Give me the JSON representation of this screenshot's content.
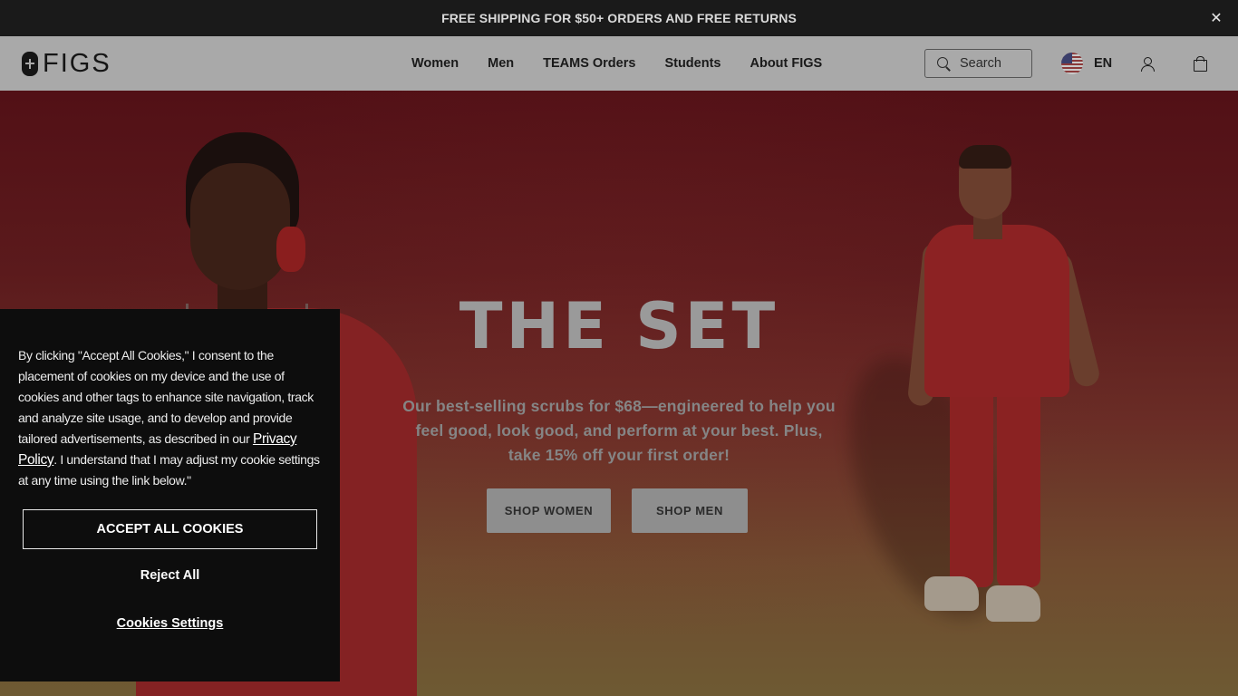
{
  "announcement": {
    "text": "FREE SHIPPING FOR $50+ ORDERS AND FREE RETURNS",
    "close_glyph": "✕"
  },
  "header": {
    "logo_text": "FIGS",
    "nav": [
      "Women",
      "Men",
      "TEAMS Orders",
      "Students",
      "About FIGS"
    ],
    "search_placeholder": "Search",
    "language": "EN",
    "icons": [
      "search-icon",
      "us-flag-icon",
      "account-icon",
      "shopping-bag-icon"
    ]
  },
  "hero": {
    "title": "THE SET",
    "subtitle": "Our best-selling scrubs for $68—engineered to help you feel good, look good, and perform at your best. Plus, take 15% off your first order!",
    "shop_women": "SHOP WOMEN",
    "shop_men": "SHOP MEN"
  },
  "cookie_banner": {
    "text_before_link": "By clicking \"Accept All Cookies,\" I consent to the placement of cookies on my device and the use of cookies and other tags to enhance site navigation, track and analyze site usage, and to develop and provide tailored advertisements, as described in our ",
    "privacy_link": "Privacy Policy",
    "text_after_link": ". I understand that I may adjust my cookie settings at any time using the link below.\"",
    "accept_label": "ACCEPT ALL COOKIES",
    "reject_label": "Reject All",
    "settings_label": "Cookies Settings"
  },
  "colors": {
    "announcement_bg": "#1a1a1a",
    "header_bg": "#a9a9a9",
    "cookie_bg": "#0d0d0d",
    "hero_top": "#521016",
    "hero_bottom": "#6e5a33"
  }
}
